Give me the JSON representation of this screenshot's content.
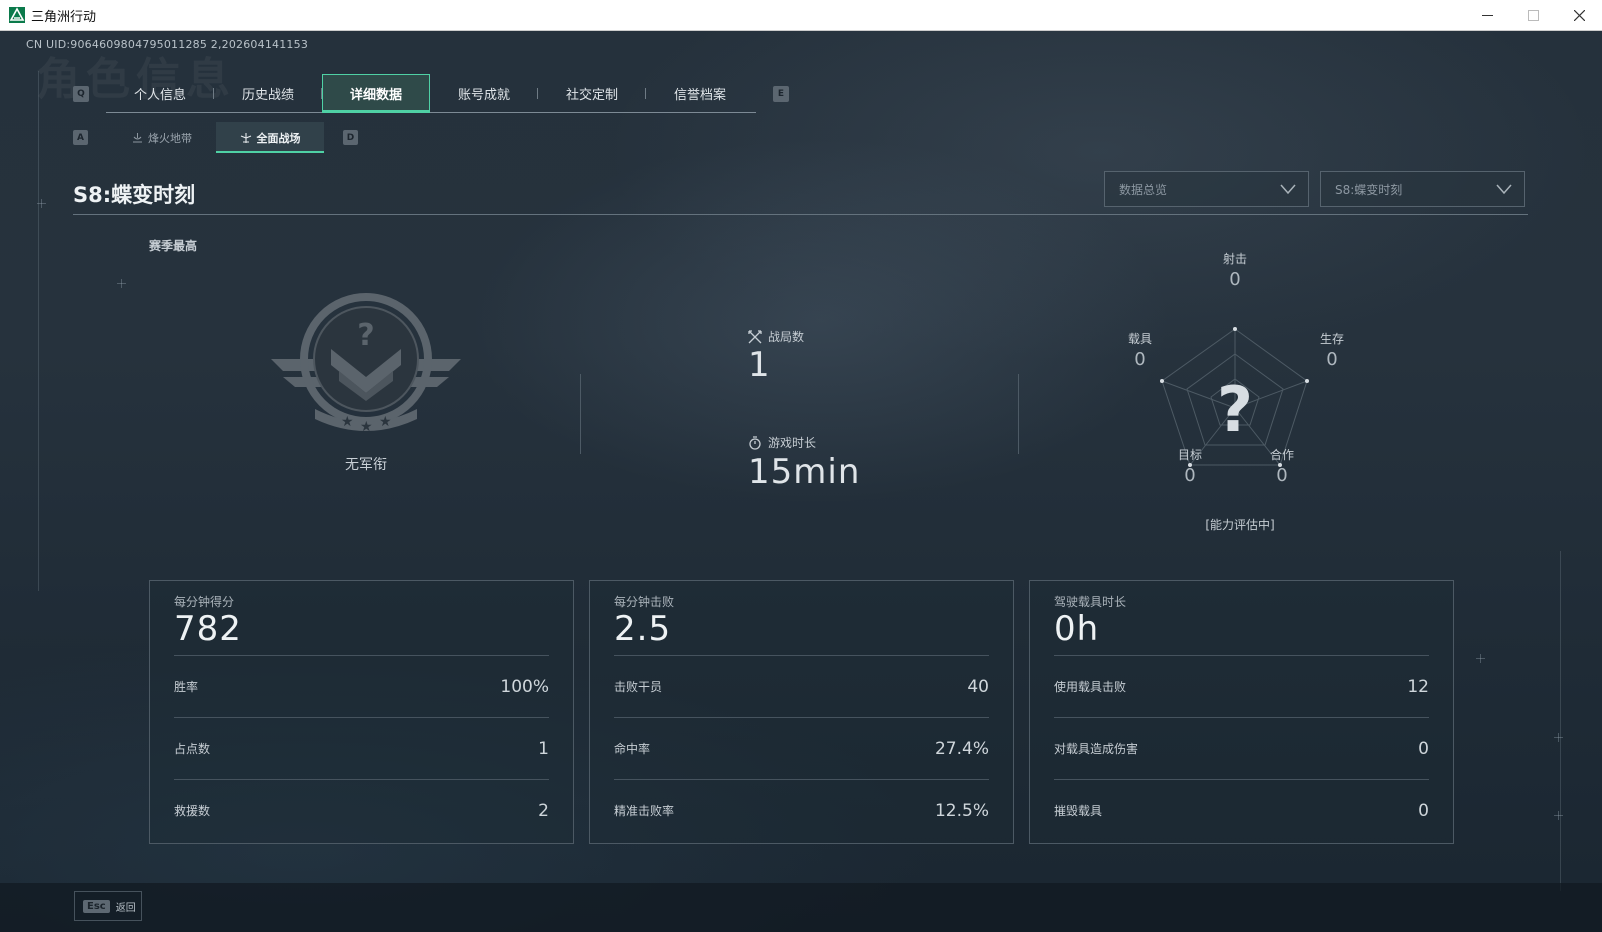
{
  "window": {
    "title": "三角洲行动",
    "controls": [
      "minimize-icon",
      "maximize-icon",
      "close-icon"
    ]
  },
  "uid": "CN UID:9064609804795011285 2,202604141153",
  "background_title": "角色信息",
  "main_tabs": {
    "prev_key": "Q",
    "next_key": "E",
    "items": [
      {
        "label": "个人信息",
        "active": false
      },
      {
        "label": "历史战绩",
        "active": false
      },
      {
        "label": "详细数据",
        "active": true
      },
      {
        "label": "账号成就",
        "active": false
      },
      {
        "label": "社交定制",
        "active": false
      },
      {
        "label": "信誉档案",
        "active": false
      }
    ]
  },
  "sub_tabs": {
    "prev_key": "A",
    "next_key": "D",
    "items": [
      {
        "label": "烽火地带",
        "icon": "beacon-icon",
        "active": false
      },
      {
        "label": "全面战场",
        "icon": "battlefield-icon",
        "active": true
      }
    ]
  },
  "section": {
    "title": "S8:蝶变时刻",
    "dropdowns": [
      {
        "value": "数据总览"
      },
      {
        "value": "S8:蝶变时刻"
      }
    ]
  },
  "rank": {
    "heading": "赛季最高",
    "name": "无军衔",
    "emblem_mark": "?"
  },
  "match_stats": {
    "matches": {
      "label": "战局数",
      "value": "1",
      "icon": "crossed-swords-icon"
    },
    "playtime": {
      "label": "游戏时长",
      "value": "15min",
      "icon": "stopwatch-icon"
    }
  },
  "radar": {
    "center_mark": "?",
    "axes": [
      {
        "label": "射击",
        "value": "0"
      },
      {
        "label": "生存",
        "value": "0"
      },
      {
        "label": "合作",
        "value": "0"
      },
      {
        "label": "目标",
        "value": "0"
      },
      {
        "label": "载具",
        "value": "0"
      }
    ],
    "status": "[能力评估中]"
  },
  "cards": [
    {
      "head_label": "每分钟得分",
      "head_value": "782",
      "rows": [
        {
          "label": "胜率",
          "value": "100%"
        },
        {
          "label": "占点数",
          "value": "1"
        },
        {
          "label": "救援数",
          "value": "2"
        }
      ]
    },
    {
      "head_label": "每分钟击败",
      "head_value": "2.5",
      "rows": [
        {
          "label": "击败干员",
          "value": "40"
        },
        {
          "label": "命中率",
          "value": "27.4%"
        },
        {
          "label": "精准击败率",
          "value": "12.5%"
        }
      ]
    },
    {
      "head_label": "驾驶载具时长",
      "head_value": "0h",
      "rows": [
        {
          "label": "使用载具击败",
          "value": "12"
        },
        {
          "label": "对载具造成伤害",
          "value": "0"
        },
        {
          "label": "摧毁载具",
          "value": "0"
        }
      ]
    }
  ],
  "footer": {
    "esc_key": "Esc",
    "back_label": "返回"
  },
  "colors": {
    "accent": "#4fd1a5",
    "background": "#1b2530"
  }
}
